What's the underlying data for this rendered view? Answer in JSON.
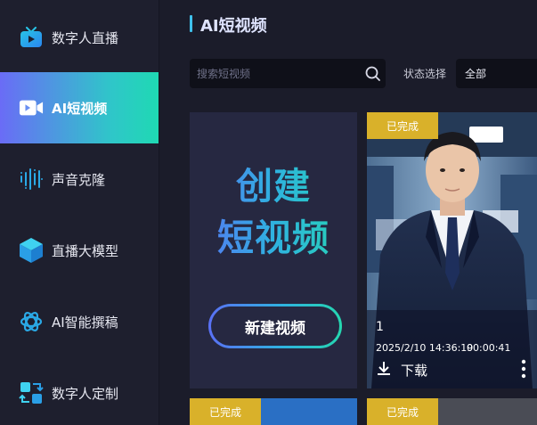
{
  "sidebar": {
    "items": [
      {
        "label": "数字人直播",
        "icon": "tv-icon",
        "active": false
      },
      {
        "label": "AI短视频",
        "icon": "video-camera-icon",
        "active": true
      },
      {
        "label": "声音克隆",
        "icon": "sound-wave-icon",
        "active": false
      },
      {
        "label": "直播大模型",
        "icon": "cube-icon",
        "active": false
      },
      {
        "label": "AI智能撰稿",
        "icon": "openai-knot-icon",
        "active": false
      },
      {
        "label": "数字人定制",
        "icon": "puzzle-custom-icon",
        "active": false
      }
    ]
  },
  "main": {
    "title": "AI短视频",
    "search": {
      "placeholder": "搜索短视频",
      "value": ""
    },
    "filter": {
      "label": "状态选择",
      "selected": "全部"
    }
  },
  "create_card": {
    "line1": "创建",
    "line2": "短视频",
    "button": "新建视频"
  },
  "videos": [
    {
      "status": "已完成",
      "name": "1",
      "date": "2025/2/10 14:36:19",
      "duration": "00:00:41",
      "download": "下载"
    }
  ],
  "next_row": [
    {
      "status": "已完成"
    },
    {
      "status": "已完成"
    }
  ],
  "colors": {
    "accent_gradient_start": "#6a6cf6",
    "accent_gradient_end": "#1fd9b3",
    "badge": "#d9b12a",
    "background": "#1b1c2a"
  }
}
